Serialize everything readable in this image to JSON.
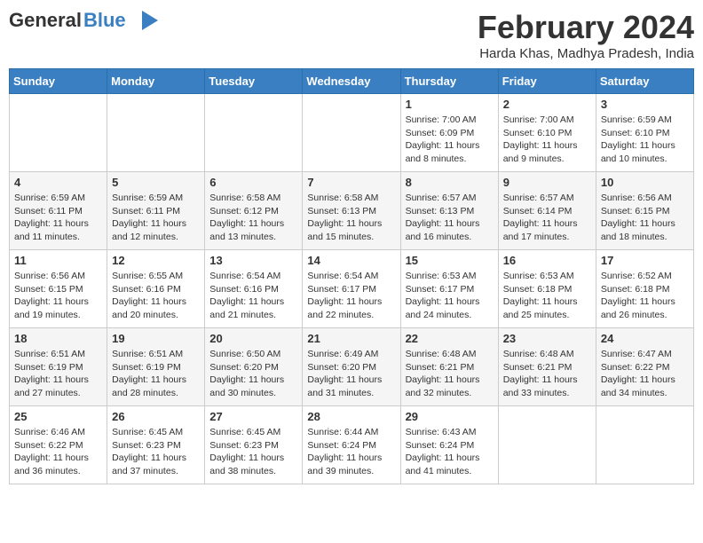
{
  "header": {
    "logo_general": "General",
    "logo_blue": "Blue",
    "month_year": "February 2024",
    "location": "Harda Khas, Madhya Pradesh, India"
  },
  "days_of_week": [
    "Sunday",
    "Monday",
    "Tuesday",
    "Wednesday",
    "Thursday",
    "Friday",
    "Saturday"
  ],
  "weeks": [
    [
      {
        "day": "",
        "info": ""
      },
      {
        "day": "",
        "info": ""
      },
      {
        "day": "",
        "info": ""
      },
      {
        "day": "",
        "info": ""
      },
      {
        "day": "1",
        "info": "Sunrise: 7:00 AM\nSunset: 6:09 PM\nDaylight: 11 hours\nand 8 minutes."
      },
      {
        "day": "2",
        "info": "Sunrise: 7:00 AM\nSunset: 6:10 PM\nDaylight: 11 hours\nand 9 minutes."
      },
      {
        "day": "3",
        "info": "Sunrise: 6:59 AM\nSunset: 6:10 PM\nDaylight: 11 hours\nand 10 minutes."
      }
    ],
    [
      {
        "day": "4",
        "info": "Sunrise: 6:59 AM\nSunset: 6:11 PM\nDaylight: 11 hours\nand 11 minutes."
      },
      {
        "day": "5",
        "info": "Sunrise: 6:59 AM\nSunset: 6:11 PM\nDaylight: 11 hours\nand 12 minutes."
      },
      {
        "day": "6",
        "info": "Sunrise: 6:58 AM\nSunset: 6:12 PM\nDaylight: 11 hours\nand 13 minutes."
      },
      {
        "day": "7",
        "info": "Sunrise: 6:58 AM\nSunset: 6:13 PM\nDaylight: 11 hours\nand 15 minutes."
      },
      {
        "day": "8",
        "info": "Sunrise: 6:57 AM\nSunset: 6:13 PM\nDaylight: 11 hours\nand 16 minutes."
      },
      {
        "day": "9",
        "info": "Sunrise: 6:57 AM\nSunset: 6:14 PM\nDaylight: 11 hours\nand 17 minutes."
      },
      {
        "day": "10",
        "info": "Sunrise: 6:56 AM\nSunset: 6:15 PM\nDaylight: 11 hours\nand 18 minutes."
      }
    ],
    [
      {
        "day": "11",
        "info": "Sunrise: 6:56 AM\nSunset: 6:15 PM\nDaylight: 11 hours\nand 19 minutes."
      },
      {
        "day": "12",
        "info": "Sunrise: 6:55 AM\nSunset: 6:16 PM\nDaylight: 11 hours\nand 20 minutes."
      },
      {
        "day": "13",
        "info": "Sunrise: 6:54 AM\nSunset: 6:16 PM\nDaylight: 11 hours\nand 21 minutes."
      },
      {
        "day": "14",
        "info": "Sunrise: 6:54 AM\nSunset: 6:17 PM\nDaylight: 11 hours\nand 22 minutes."
      },
      {
        "day": "15",
        "info": "Sunrise: 6:53 AM\nSunset: 6:17 PM\nDaylight: 11 hours\nand 24 minutes."
      },
      {
        "day": "16",
        "info": "Sunrise: 6:53 AM\nSunset: 6:18 PM\nDaylight: 11 hours\nand 25 minutes."
      },
      {
        "day": "17",
        "info": "Sunrise: 6:52 AM\nSunset: 6:18 PM\nDaylight: 11 hours\nand 26 minutes."
      }
    ],
    [
      {
        "day": "18",
        "info": "Sunrise: 6:51 AM\nSunset: 6:19 PM\nDaylight: 11 hours\nand 27 minutes."
      },
      {
        "day": "19",
        "info": "Sunrise: 6:51 AM\nSunset: 6:19 PM\nDaylight: 11 hours\nand 28 minutes."
      },
      {
        "day": "20",
        "info": "Sunrise: 6:50 AM\nSunset: 6:20 PM\nDaylight: 11 hours\nand 30 minutes."
      },
      {
        "day": "21",
        "info": "Sunrise: 6:49 AM\nSunset: 6:20 PM\nDaylight: 11 hours\nand 31 minutes."
      },
      {
        "day": "22",
        "info": "Sunrise: 6:48 AM\nSunset: 6:21 PM\nDaylight: 11 hours\nand 32 minutes."
      },
      {
        "day": "23",
        "info": "Sunrise: 6:48 AM\nSunset: 6:21 PM\nDaylight: 11 hours\nand 33 minutes."
      },
      {
        "day": "24",
        "info": "Sunrise: 6:47 AM\nSunset: 6:22 PM\nDaylight: 11 hours\nand 34 minutes."
      }
    ],
    [
      {
        "day": "25",
        "info": "Sunrise: 6:46 AM\nSunset: 6:22 PM\nDaylight: 11 hours\nand 36 minutes."
      },
      {
        "day": "26",
        "info": "Sunrise: 6:45 AM\nSunset: 6:23 PM\nDaylight: 11 hours\nand 37 minutes."
      },
      {
        "day": "27",
        "info": "Sunrise: 6:45 AM\nSunset: 6:23 PM\nDaylight: 11 hours\nand 38 minutes."
      },
      {
        "day": "28",
        "info": "Sunrise: 6:44 AM\nSunset: 6:24 PM\nDaylight: 11 hours\nand 39 minutes."
      },
      {
        "day": "29",
        "info": "Sunrise: 6:43 AM\nSunset: 6:24 PM\nDaylight: 11 hours\nand 41 minutes."
      },
      {
        "day": "",
        "info": ""
      },
      {
        "day": "",
        "info": ""
      }
    ]
  ]
}
